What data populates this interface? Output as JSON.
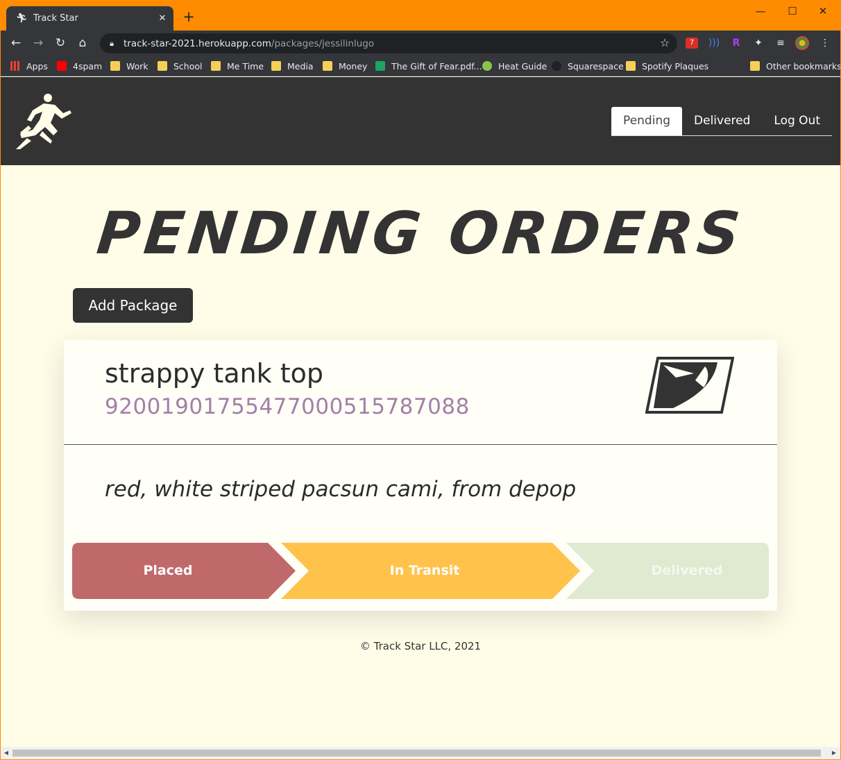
{
  "browser": {
    "tab_title": "Track Star",
    "url_host": "track-star-2021.herokuapp.com",
    "url_path": "/packages/jessilinlugo",
    "extension_badge": "7",
    "bookmarks": [
      "Apps",
      "4spam",
      "Work",
      "School",
      "Me Time",
      "Media",
      "Money",
      "The Gift of Fear.pdf...",
      "Heat Guide",
      "Squarespace",
      "Spotify Plaques"
    ],
    "other_bookmarks": "Other bookmarks"
  },
  "nav": {
    "pending": "Pending",
    "delivered": "Delivered",
    "logout": "Log Out"
  },
  "page": {
    "heading": "PENDING ORDERS",
    "add_button": "Add Package",
    "footer": "© Track Star LLC, 2021"
  },
  "package": {
    "name": "strappy tank top",
    "tracking_number": "9200190175547700051578708​8",
    "description": "red, white striped pacsun cami, from depop",
    "carrier_icon": "usps-eagle-icon",
    "status_steps": [
      {
        "label": "Placed",
        "color": "#c0696b"
      },
      {
        "label": "In Transit",
        "color": "#ffc24b"
      },
      {
        "label": "Delivered",
        "color": "#dfead1"
      }
    ]
  },
  "colors": {
    "header_bg": "#333333",
    "page_bg": "#fffde8",
    "tracking": "#a37fa8",
    "window_frame": "#ff8c00"
  }
}
